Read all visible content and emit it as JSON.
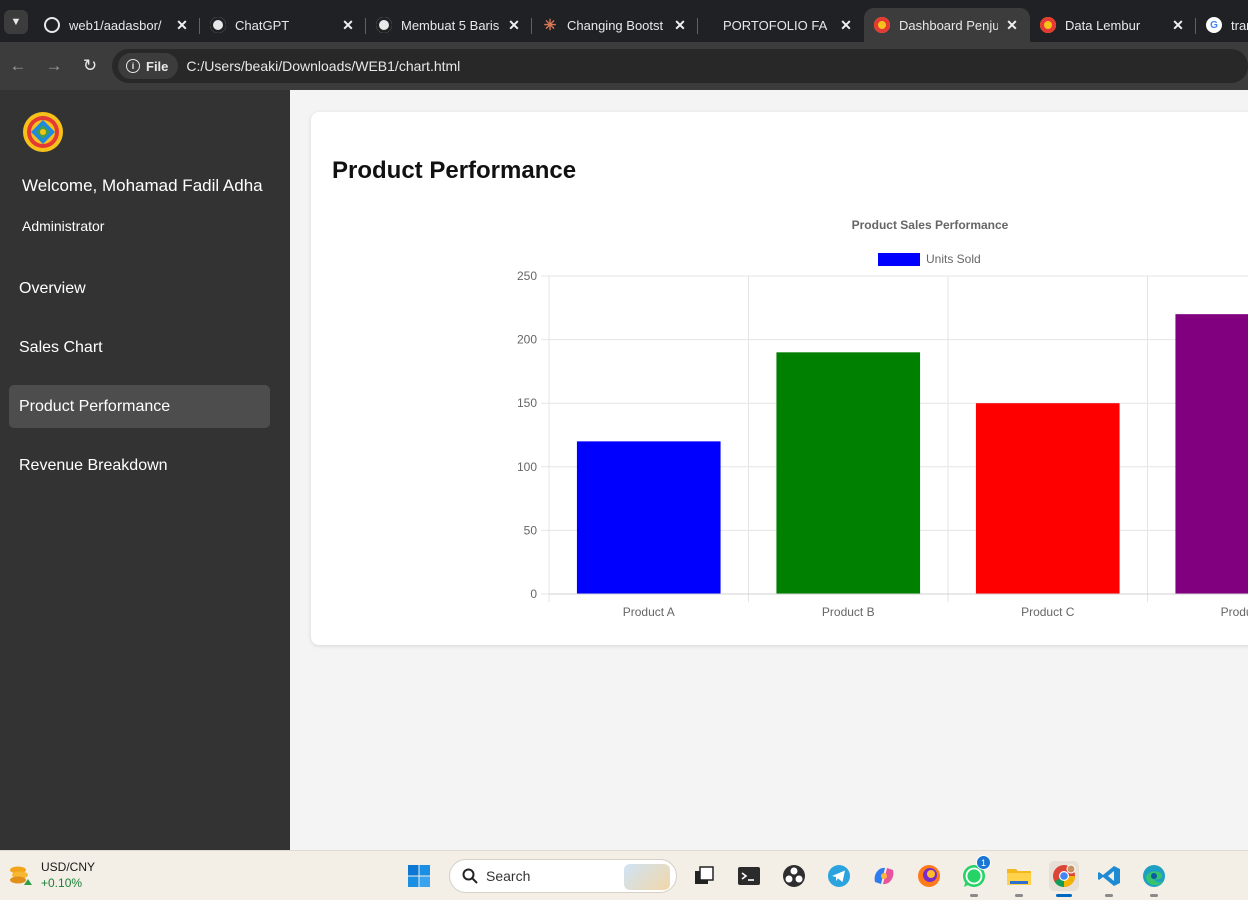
{
  "browser": {
    "tabs": [
      {
        "title": "web1/aadasbor/",
        "favicon": "github-icon",
        "color": "#e8e8e8"
      },
      {
        "title": "ChatGPT",
        "favicon": "chatgpt-icon",
        "color": "#e8e8e8"
      },
      {
        "title": "Membuat 5 Baris",
        "favicon": "chatgpt-icon",
        "color": "#e8e8e8"
      },
      {
        "title": "Changing Bootst",
        "favicon": "claude-icon",
        "color": "#d97757"
      },
      {
        "title": "PORTOFOLIO FA",
        "favicon": "none",
        "color": "#e8e8e8"
      },
      {
        "title": "Dashboard Penju",
        "favicon": "logo-icon",
        "color": "#f6c21a",
        "active": true
      },
      {
        "title": "Data Lembur",
        "favicon": "logo-icon",
        "color": "#f6c21a"
      },
      {
        "title": "tran",
        "favicon": "google-icon",
        "color": "#4285f4"
      }
    ],
    "address": {
      "chip_label": "File",
      "url": "C:/Users/beaki/Downloads/WEB1/chart.html"
    }
  },
  "sidebar": {
    "welcome": "Welcome, Mohamad Fadil Adha",
    "role": "Administrator",
    "items": [
      {
        "label": "Overview"
      },
      {
        "label": "Sales Chart"
      },
      {
        "label": "Product Performance",
        "active": true
      },
      {
        "label": "Revenue Breakdown"
      }
    ]
  },
  "main": {
    "title": "Product Performance"
  },
  "chart_data": {
    "type": "bar",
    "title": "Product Sales Performance",
    "legend": "top",
    "series": [
      {
        "name": "Units Sold",
        "values": [
          120,
          190,
          150,
          220
        ]
      }
    ],
    "categories": [
      "Product A",
      "Product B",
      "Product C",
      "Product D"
    ],
    "colors": [
      "#0000ff",
      "#008000",
      "#ff0000",
      "#800080"
    ],
    "ylim": [
      0,
      250
    ],
    "yticks": [
      0,
      50,
      100,
      150,
      200,
      250
    ],
    "grid": true
  },
  "taskbar": {
    "widget": {
      "name": "USD/CNY",
      "change": "+0.10%"
    },
    "search_placeholder": "Search",
    "whatsapp_badge": "1"
  }
}
